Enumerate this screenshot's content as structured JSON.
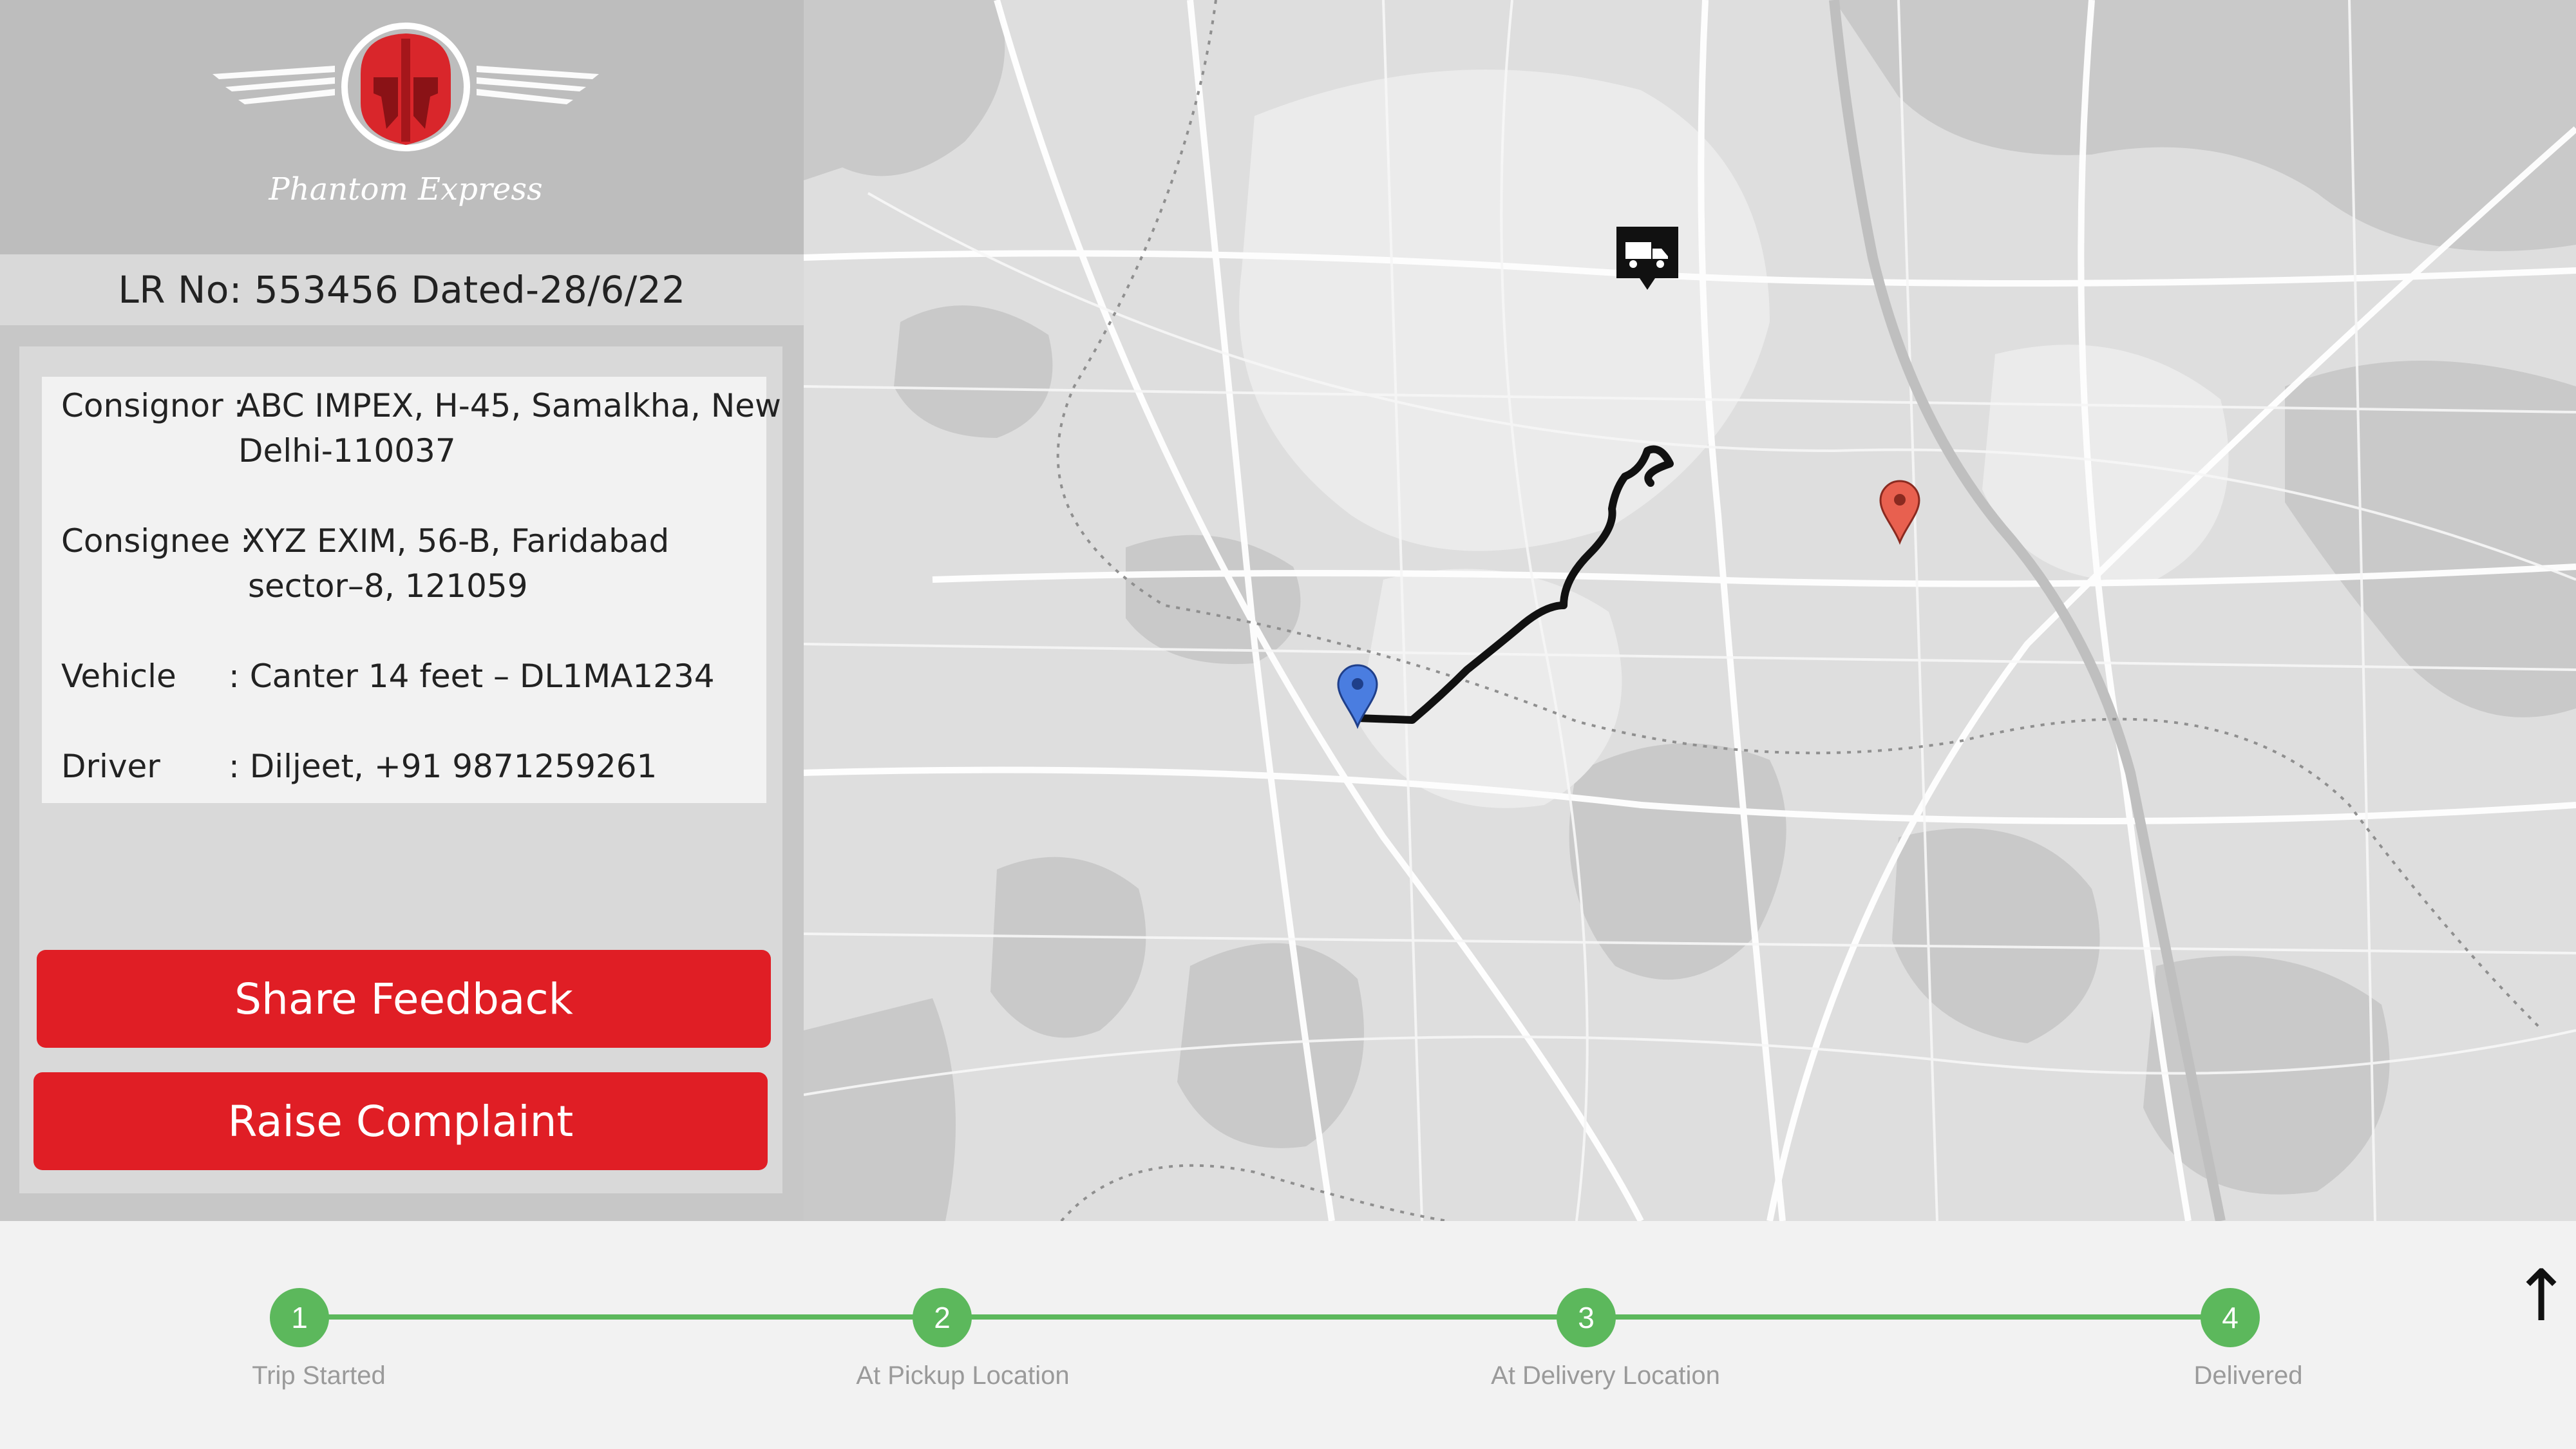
{
  "brand": {
    "name": "Phantom Express",
    "accent": "#e01e25"
  },
  "lr": {
    "text": "LR No: 553456 Dated-28/6/22"
  },
  "shipment": {
    "consignor_label": "Consignor :",
    "consignor_line1": "ABC IMPEX, H-45, Samalkha, New",
    "consignor_line2": "Delhi-110037",
    "consignee_label": "Consignee :",
    "consignee_line1": "XYZ EXIM, 56-B, Faridabad",
    "consignee_line2": "sector–8, 121059",
    "vehicle_label": "Vehicle",
    "vehicle_value": ": Canter 14 feet – DL1MA1234",
    "driver_label": "Driver",
    "driver_value": ": Diljeet, +91 9871259261"
  },
  "actions": {
    "feedback_label": "Share Feedback",
    "complaint_label": "Raise Complaint"
  },
  "map": {
    "origin_marker": "blue-pin-icon",
    "destination_marker": "red-pin-icon",
    "vehicle_marker": "truck-icon"
  },
  "tracker": {
    "steps": [
      {
        "number": "1",
        "label": "Trip Started"
      },
      {
        "number": "2",
        "label": "At Pickup Location"
      },
      {
        "number": "3",
        "label": "At Delivery Location"
      },
      {
        "number": "4",
        "label": "Delivered"
      }
    ],
    "color": "#5cb85c",
    "scroll_icon": "up-arrow-icon"
  }
}
